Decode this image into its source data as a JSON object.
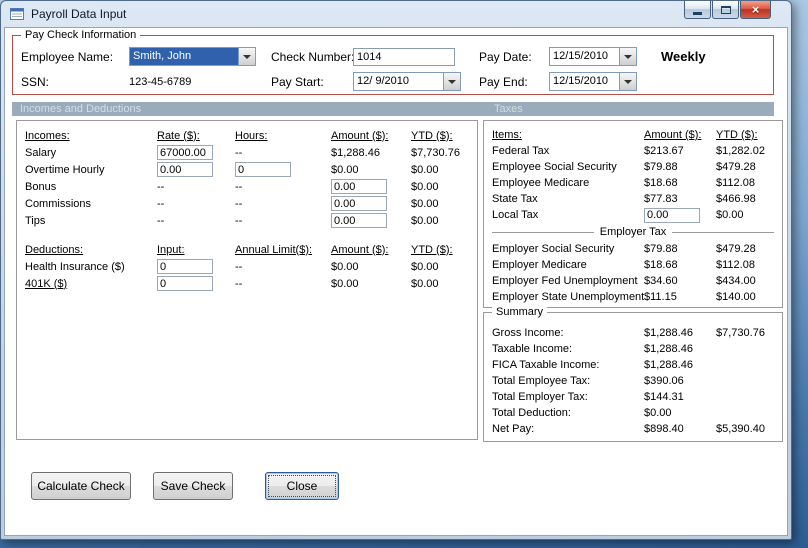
{
  "window": {
    "title": "Payroll Data Input",
    "close_glyph": "×"
  },
  "colors": {
    "groupbox_border": "#b05046",
    "section_header_bg": "#9aabbc",
    "selection_bg": "#2f61ad",
    "close_button_red": "#b93322",
    "desktop_top": "#b9d2ea",
    "desktop_bottom": "#2d5c92"
  },
  "icons": {
    "app": "form-window-icon",
    "minimize": "minimize-icon",
    "maximize": "maximize-icon",
    "close": "close-icon",
    "combo_arrow": "chevron-down-icon"
  },
  "paycheck": {
    "legend": "Pay Check Information",
    "employee_name_label": "Employee Name:",
    "employee_name_value": "Smith, John",
    "ssn_label": "SSN:",
    "ssn_value": "123-45-6789",
    "check_number_label": "Check Number:",
    "check_number_value": "1014",
    "pay_start_label": "Pay Start:",
    "pay_start_value": "12/ 9/2010",
    "pay_date_label": "Pay Date:",
    "pay_date_value": "12/15/2010",
    "pay_end_label": "Pay End:",
    "pay_end_value": "12/15/2010",
    "frequency": "Weekly"
  },
  "section_bar": {
    "left": "Incomes and Deductions",
    "right": "Taxes"
  },
  "incomes": {
    "headers": [
      "Incomes:",
      "Rate ($):",
      "Hours:",
      "Amount ($):",
      "YTD ($):"
    ],
    "rows": [
      {
        "label": "Salary",
        "rate": "67000.00",
        "hours": "--",
        "amount": "$1,288.46",
        "ytd": "$7,730.76"
      },
      {
        "label": "Overtime Hourly",
        "rate": "0.00",
        "hours": "0",
        "amount": "$0.00",
        "ytd": "$0.00"
      },
      {
        "label": "Bonus",
        "rate": "--",
        "hours": "--",
        "amount": "0.00",
        "ytd": "$0.00"
      },
      {
        "label": "Commissions",
        "rate": "--",
        "hours": "--",
        "amount": "0.00",
        "ytd": "$0.00"
      },
      {
        "label": "Tips",
        "rate": "--",
        "hours": "--",
        "amount": "0.00",
        "ytd": "$0.00"
      }
    ]
  },
  "deductions": {
    "headers": [
      "Deductions:",
      "Input:",
      "Annual Limit($):",
      "Amount ($):",
      "YTD ($):"
    ],
    "rows": [
      {
        "label": "Health Insurance  ($)",
        "input": "0",
        "limit": "--",
        "amount": "$0.00",
        "ytd": "$0.00"
      },
      {
        "label": "401K  ($)",
        "input": "0",
        "limit": "--",
        "amount": "$0.00",
        "ytd": "$0.00"
      }
    ]
  },
  "taxes": {
    "headers": [
      "Items:",
      "Amount ($):",
      "YTD ($):"
    ],
    "employee_rows": [
      {
        "label": "Federal Tax",
        "amount": "$213.67",
        "ytd": "$1,282.02"
      },
      {
        "label": "Employee Social Security",
        "amount": "$79.88",
        "ytd": "$479.28"
      },
      {
        "label": "Employee Medicare",
        "amount": "$18.68",
        "ytd": "$112.08"
      },
      {
        "label": "State Tax",
        "amount": "$77.83",
        "ytd": "$466.98"
      },
      {
        "label": "Local Tax",
        "amount": "0.00",
        "ytd": "$0.00"
      }
    ],
    "employer_header": "Employer Tax",
    "employer_rows": [
      {
        "label": "Employer Social Security",
        "amount": "$79.88",
        "ytd": "$479.28"
      },
      {
        "label": "Employer Medicare",
        "amount": "$18.68",
        "ytd": "$112.08"
      },
      {
        "label": "Employer Fed Unemployment",
        "amount": "$34.60",
        "ytd": "$434.00"
      },
      {
        "label": "Employer State Unemployment",
        "amount": "$11.15",
        "ytd": "$140.00"
      }
    ]
  },
  "summary": {
    "legend": "Summary",
    "rows": [
      {
        "label": "Gross Income:",
        "amount": "$1,288.46",
        "ytd": "$7,730.76"
      },
      {
        "label": "Taxable Income:",
        "amount": "$1,288.46",
        "ytd": ""
      },
      {
        "label": "FICA Taxable Income:",
        "amount": "$1,288.46",
        "ytd": ""
      },
      {
        "label": "Total Employee Tax:",
        "amount": "$390.06",
        "ytd": ""
      },
      {
        "label": "Total Employer Tax:",
        "amount": "$144.31",
        "ytd": ""
      },
      {
        "label": "Total Deduction:",
        "amount": "$0.00",
        "ytd": ""
      },
      {
        "label": "Net Pay:",
        "amount": "$898.40",
        "ytd": "$5,390.40"
      }
    ]
  },
  "buttons": {
    "calculate": "Calculate Check",
    "save": "Save Check",
    "close": "Close"
  }
}
